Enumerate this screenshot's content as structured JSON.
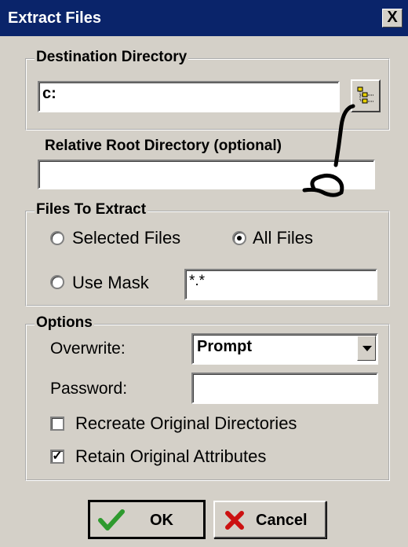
{
  "window": {
    "title": "Extract Files",
    "close_glyph": "X"
  },
  "destination": {
    "legend": "Destination Directory",
    "value": "c:",
    "browse_icon": "folder-tree-icon"
  },
  "relative_root": {
    "label": "Relative Root Directory (optional)",
    "value": ""
  },
  "files": {
    "legend": "Files To Extract",
    "selected_label": "Selected Files",
    "all_label": "All Files",
    "mask_label": "Use Mask",
    "mask_value": "*.*",
    "selected_option": "All Files"
  },
  "options": {
    "legend": "Options",
    "overwrite_label": "Overwrite:",
    "overwrite_value": "Prompt",
    "password_label": "Password:",
    "password_value": "",
    "recreate_label": "Recreate Original Directories",
    "recreate_checked": false,
    "retain_label": "Retain Original Attributes",
    "retain_checked": true,
    "check_glyph": "✓"
  },
  "buttons": {
    "ok_label": "OK",
    "cancel_label": "Cancel"
  },
  "colors": {
    "titlebar": "#0a246a",
    "face": "#d4d0c8",
    "ok_check": "#2e9a2e",
    "cancel_x": "#cc1111"
  }
}
